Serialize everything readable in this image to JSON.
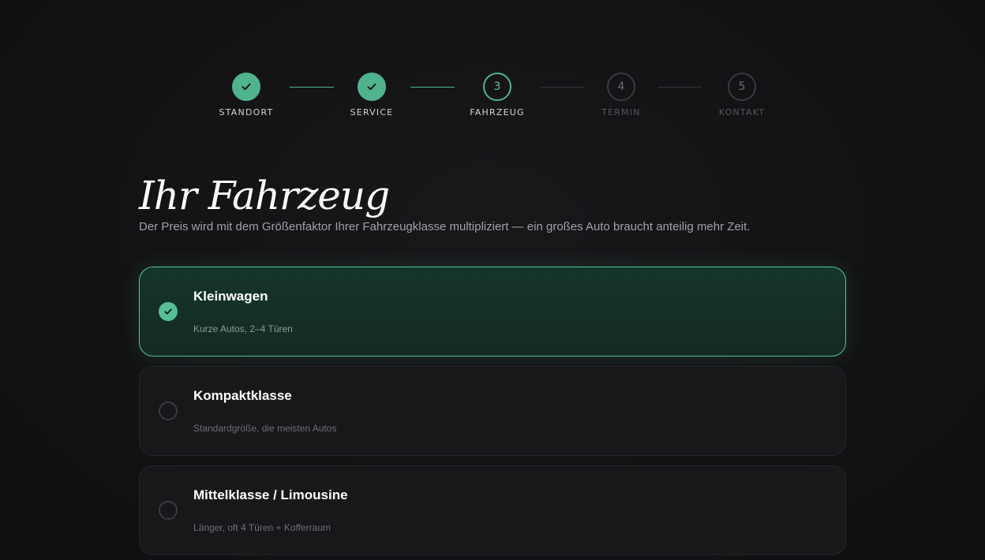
{
  "stepper": {
    "steps": [
      {
        "number": "1",
        "label": "STANDORT",
        "state": "done"
      },
      {
        "number": "2",
        "label": "SERVICE",
        "state": "done"
      },
      {
        "number": "3",
        "label": "FAHRZEUG",
        "state": "current"
      },
      {
        "number": "4",
        "label": "TERMIN",
        "state": "todo"
      },
      {
        "number": "5",
        "label": "KONTAKT",
        "state": "todo"
      }
    ]
  },
  "header": {
    "title": "Ihr Fahrzeug",
    "subtitle": "Der Preis wird mit dem Größenfaktor Ihrer Fahrzeugklasse multipliziert — ein großes Auto braucht anteilig mehr Zeit."
  },
  "options": [
    {
      "title": "Kleinwagen",
      "description": "Kurze Autos, 2–4 Türen",
      "selected": true
    },
    {
      "title": "Kompaktklasse",
      "description": "Standardgröße, die meisten Autos",
      "selected": false
    },
    {
      "title": "Mittelklasse / Limousine",
      "description": "Länger, oft 4 Türen + Kofferraum",
      "selected": false
    }
  ],
  "icons": {
    "done": "check-icon",
    "selected": "check-icon"
  },
  "colors": {
    "accent": "#4fb38e",
    "background": "#121214",
    "card": "#18181b"
  }
}
